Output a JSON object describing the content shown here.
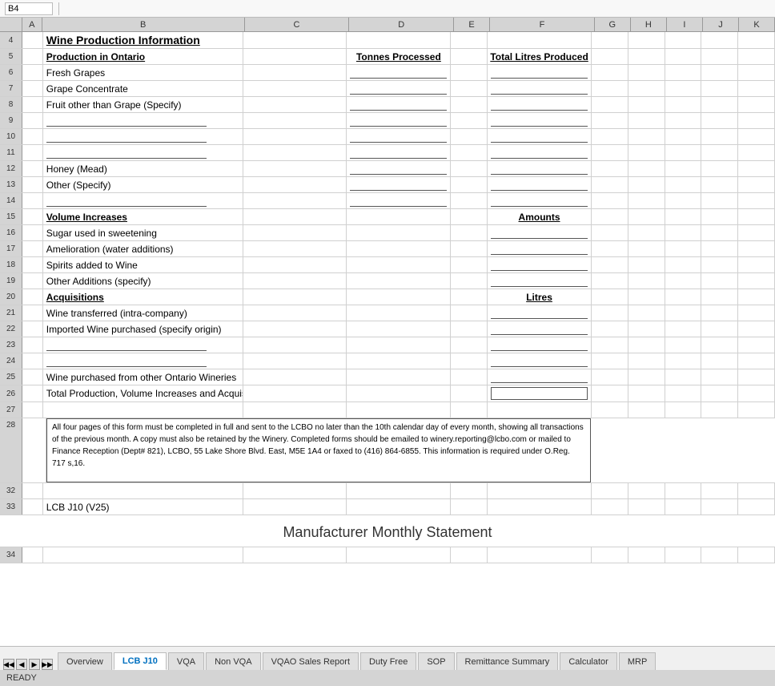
{
  "header": {
    "title": "Wine Production Information"
  },
  "formula_bar": {
    "name_box": "B4"
  },
  "columns": {
    "headers": [
      "",
      "A",
      "B",
      "C",
      "D",
      "E",
      "F",
      "G",
      "H",
      "I",
      "J",
      "K"
    ]
  },
  "rows": {
    "row4": {
      "num": "4",
      "b": "Wine Production Information"
    },
    "row5": {
      "num": "5",
      "b": "Production in Ontario",
      "d": "Tonnes Processed",
      "f": "Total Litres Produced"
    },
    "row6": {
      "num": "6",
      "b": "Fresh Grapes"
    },
    "row7": {
      "num": "7",
      "b": "Grape Concentrate"
    },
    "row8": {
      "num": "8",
      "b": "Fruit other than Grape (Specify)"
    },
    "row9": {
      "num": "9",
      "b": ""
    },
    "row10": {
      "num": "10",
      "b": ""
    },
    "row11": {
      "num": "11",
      "b": ""
    },
    "row12": {
      "num": "12",
      "b": "Honey (Mead)"
    },
    "row13": {
      "num": "13",
      "b": "Other (Specify)"
    },
    "row14": {
      "num": "14",
      "b": ""
    },
    "row15": {
      "num": "15",
      "b": "Volume Increases",
      "f": "Amounts"
    },
    "row16": {
      "num": "16",
      "b": "Sugar used in sweetening"
    },
    "row17": {
      "num": "17",
      "b": "Amelioration (water additions)"
    },
    "row18": {
      "num": "18",
      "b": "Spirits added to Wine"
    },
    "row19": {
      "num": "19",
      "b": "Other Additions (specify)"
    },
    "row20": {
      "num": "20",
      "b": "Acquisitions",
      "f": "Litres"
    },
    "row21": {
      "num": "21",
      "b": "Wine transferred (intra-company)"
    },
    "row22": {
      "num": "22",
      "b": "Imported Wine purchased (specify origin)"
    },
    "row23": {
      "num": "23",
      "b": ""
    },
    "row24": {
      "num": "24",
      "b": ""
    },
    "row25": {
      "num": "25",
      "b": "Wine purchased from other Ontario Wineries"
    },
    "row26": {
      "num": "26",
      "b": "Total Production, Volume Increases and Acquisitions"
    },
    "row27": {
      "num": "27",
      "b": ""
    },
    "row28_31": {
      "notice": "All four pages of this form must be completed in full and sent to the LCBO no later than the 10th calendar day of every month, showing all transactions of the previous month. A copy must also be retained by the Winery. Completed forms should be emailed to winery.reporting@lcbo.com or mailed to Finance Reception (Dept# 821), LCBO, 55 Lake Shore Blvd. East, M5E 1A4 or faxed to (416) 864-6855. This information is required under O.Reg. 717 s,16."
    },
    "row33": {
      "num": "33",
      "b": "LCB J10 (V25)"
    },
    "row34_title": "Manufacturer Monthly Statement"
  },
  "tabs": [
    {
      "id": "overview",
      "label": "Overview",
      "active": false
    },
    {
      "id": "lcb-j10",
      "label": "LCB J10",
      "active": true
    },
    {
      "id": "vqa",
      "label": "VQA",
      "active": false
    },
    {
      "id": "non-vqa",
      "label": "Non VQA",
      "active": false
    },
    {
      "id": "vqao-sales-report",
      "label": "VQAO Sales Report",
      "active": false
    },
    {
      "id": "duty-free",
      "label": "Duty Free",
      "active": false
    },
    {
      "id": "sop",
      "label": "SOP",
      "active": false
    },
    {
      "id": "remittance-summary",
      "label": "Remittance Summary",
      "active": false
    },
    {
      "id": "calculator",
      "label": "Calculator",
      "active": false
    },
    {
      "id": "mrp",
      "label": "MRP",
      "active": false
    }
  ],
  "status": {
    "ready": "READY"
  }
}
